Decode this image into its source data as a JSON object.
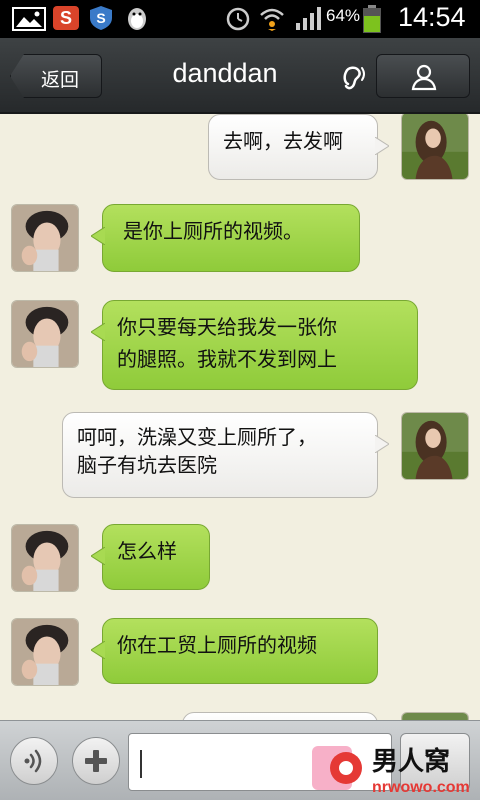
{
  "status_bar": {
    "battery_percent": "64%",
    "time": "14:54",
    "icons": [
      "gallery-icon",
      "s-app-icon",
      "shield-app-icon",
      "qq-penguin-icon",
      "alarm-icon",
      "wifi-icon",
      "signal-icon",
      "battery-icon"
    ]
  },
  "header": {
    "back_label": "返回",
    "contact_name": "danddan",
    "ear_icon": "earpiece-icon",
    "profile_icon": "person-icon"
  },
  "messages": [
    {
      "side": "right",
      "sender": "self",
      "bubble_color": "white",
      "text": [
        "去啊，去发啊"
      ]
    },
    {
      "side": "left",
      "sender": "contact",
      "bubble_color": "green",
      "text": [
        "是你上厕所的视频。"
      ]
    },
    {
      "side": "left",
      "sender": "contact",
      "bubble_color": "green",
      "text": [
        "你只要每天给我发一张你",
        "的腿照。我就不发到网上"
      ]
    },
    {
      "side": "right",
      "sender": "self",
      "bubble_color": "white",
      "text": [
        "呵呵，洗澡又变上厕所了，",
        "脑子有坑去医院"
      ]
    },
    {
      "side": "left",
      "sender": "contact",
      "bubble_color": "green",
      "text": [
        "怎么样"
      ]
    },
    {
      "side": "left",
      "sender": "contact",
      "bubble_color": "green",
      "text": [
        "你在工贸上厕所的视频"
      ]
    }
  ],
  "input_bar": {
    "voice_icon": "voice-wave-icon",
    "plus_icon": "plus-icon",
    "message_value": ""
  },
  "watermark": {
    "brand": "男人窝",
    "site": "nrwowo.com"
  },
  "colors": {
    "chat_background": "#f2efe0",
    "green_bubble": "#9fd548",
    "white_bubble": "#ffffff",
    "titlebar": "#2f3234"
  }
}
